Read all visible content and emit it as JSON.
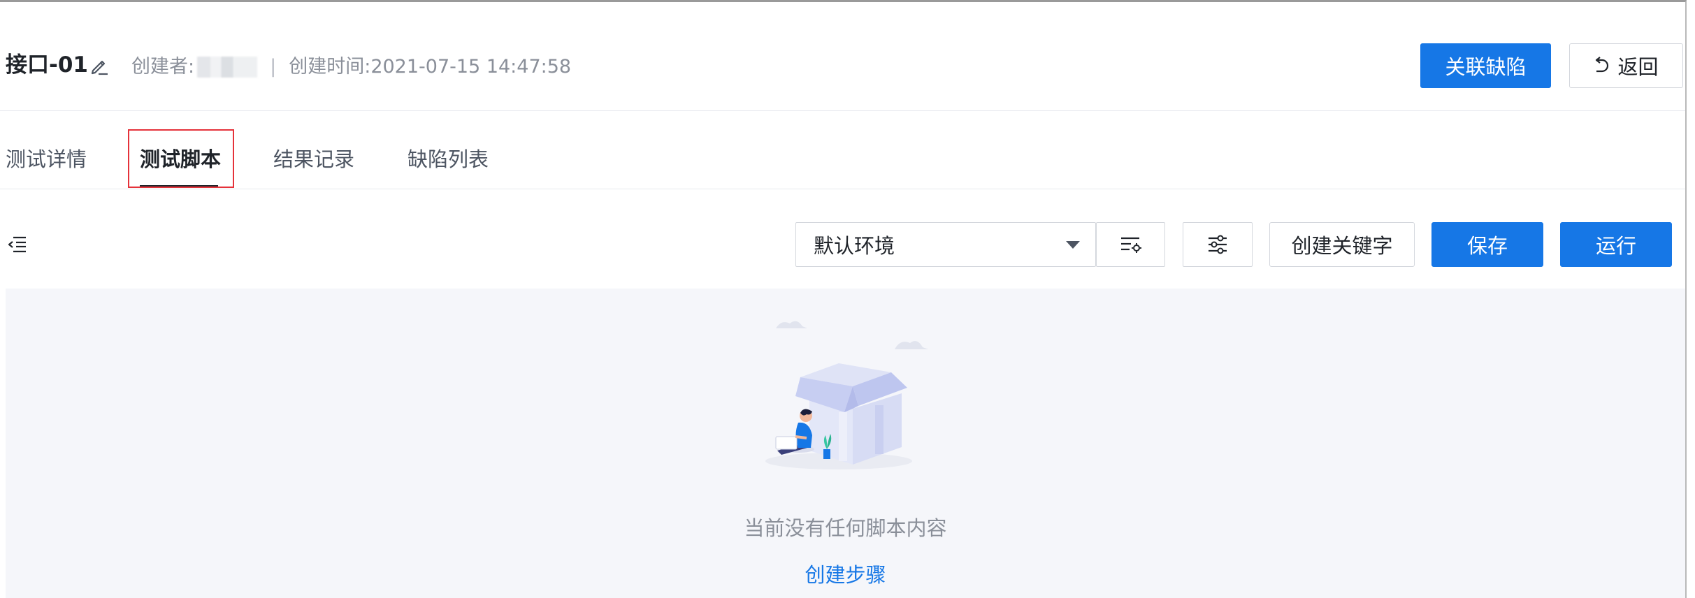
{
  "header": {
    "title": "接口-01",
    "creator_label": "创建者:",
    "separator": "|",
    "created_time_label": "创建时间:",
    "created_time": "2021-07-15 14:47:58",
    "link_defect_label": "关联缺陷",
    "back_label": "返回"
  },
  "tabs": [
    {
      "label": "测试详情",
      "active": false
    },
    {
      "label": "测试脚本",
      "active": true
    },
    {
      "label": "结果记录",
      "active": false
    },
    {
      "label": "缺陷列表",
      "active": false
    }
  ],
  "toolbar": {
    "environment_selected": "默认环境",
    "create_keyword_label": "创建关键字",
    "save_label": "保存",
    "run_label": "运行"
  },
  "empty_state": {
    "message": "当前没有任何脚本内容",
    "create_step_label": "创建步骤"
  },
  "colors": {
    "primary": "#1677e6",
    "highlight_border": "#e5323a",
    "empty_background": "#f5f6fa"
  },
  "icons": {
    "edit": "pencil-icon",
    "back": "undo-arrow-icon",
    "outline": "outline-collapse-icon",
    "env_settings": "list-settings-icon",
    "filter": "sliders-icon"
  }
}
